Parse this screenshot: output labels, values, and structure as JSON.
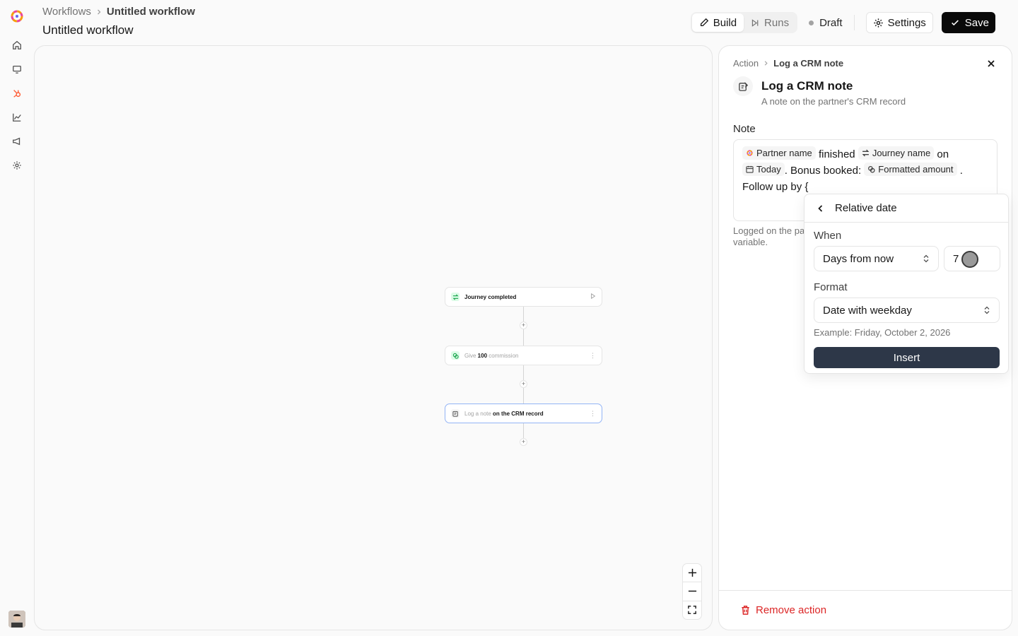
{
  "header": {
    "breadcrumb_root": "Workflows",
    "breadcrumb_current": "Untitled workflow",
    "title": "Untitled workflow",
    "tabs": [
      {
        "label": "Build",
        "active": true
      },
      {
        "label": "Runs",
        "active": false
      }
    ],
    "status": "Draft",
    "settings_label": "Settings",
    "save_label": "Save"
  },
  "canvas": {
    "nodes": [
      {
        "icon": "arrows-icon",
        "text": "Journey completed"
      },
      {
        "icon": "money-icon",
        "pre": "Give ",
        "bold": "100",
        "post": " commission"
      },
      {
        "icon": "note-icon",
        "pre": "Log a note ",
        "bold": "on the CRM record"
      }
    ]
  },
  "panel": {
    "breadcrumb_root": "Action",
    "breadcrumb_current": "Log a CRM note",
    "title": "Log a CRM note",
    "subtitle": "A note on the partner's CRM record",
    "field_label": "Note",
    "note": {
      "chip_partner": "Partner name",
      "text_finished": "finished",
      "chip_journey": "Journey name",
      "text_on": "on",
      "chip_today": "Today",
      "text_bonus": ". Bonus booked:",
      "chip_amount": "Formatted amount",
      "text_period": ".",
      "text_follow": "Follow up by {"
    },
    "hint": "Logged on the pa variable.",
    "remove_label": "Remove action"
  },
  "popover": {
    "title": "Relative date",
    "when_label": "When",
    "when_value": "Days from now",
    "amount_value": "7",
    "format_label": "Format",
    "format_value": "Date with weekday",
    "example": "Example: Friday, October 2, 2026",
    "insert_label": "Insert"
  },
  "colors": {
    "accent_dark": "#0a0a0a",
    "insert_button": "#2d3748",
    "danger": "#dc2626",
    "selected_node_border": "#93b4f5",
    "hubspot_orange": "#ff5c35"
  }
}
